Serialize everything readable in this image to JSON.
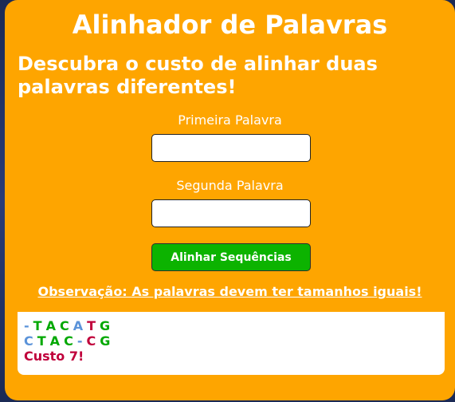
{
  "header": {
    "title": "Alinhador de Palavras",
    "subtitle": "Descubra o custo de alinhar duas palavras diferentes!"
  },
  "form": {
    "first_label": "Primeira Palavra",
    "first_value": "",
    "second_label": "Segunda Palavra",
    "second_value": "",
    "button_label": "Alinhar Sequências"
  },
  "note": "Observação: As palavras devem ter tamanhos iguais!",
  "result": {
    "row1": [
      {
        "ch": "-",
        "color": "#5b93d9"
      },
      {
        "ch": "T",
        "color": "#00a800"
      },
      {
        "ch": "A",
        "color": "#00a800"
      },
      {
        "ch": "C",
        "color": "#00a800"
      },
      {
        "ch": "A",
        "color": "#5b93d9"
      },
      {
        "ch": "T",
        "color": "#c0003b"
      },
      {
        "ch": "G",
        "color": "#00a800"
      }
    ],
    "row2": [
      {
        "ch": "C",
        "color": "#5b93d9"
      },
      {
        "ch": "T",
        "color": "#00a800"
      },
      {
        "ch": "A",
        "color": "#00a800"
      },
      {
        "ch": "C",
        "color": "#00a800"
      },
      {
        "ch": "-",
        "color": "#5b93d9"
      },
      {
        "ch": "C",
        "color": "#c0003b"
      },
      {
        "ch": "G",
        "color": "#00a800"
      }
    ],
    "cost_text": "Custo 7!",
    "cost_color": "#c0003b"
  },
  "colors": {
    "card_bg": "#fea500",
    "button_bg": "#0cb300",
    "match": "#00a800",
    "gap": "#5b93d9",
    "mismatch": "#c0003b"
  }
}
